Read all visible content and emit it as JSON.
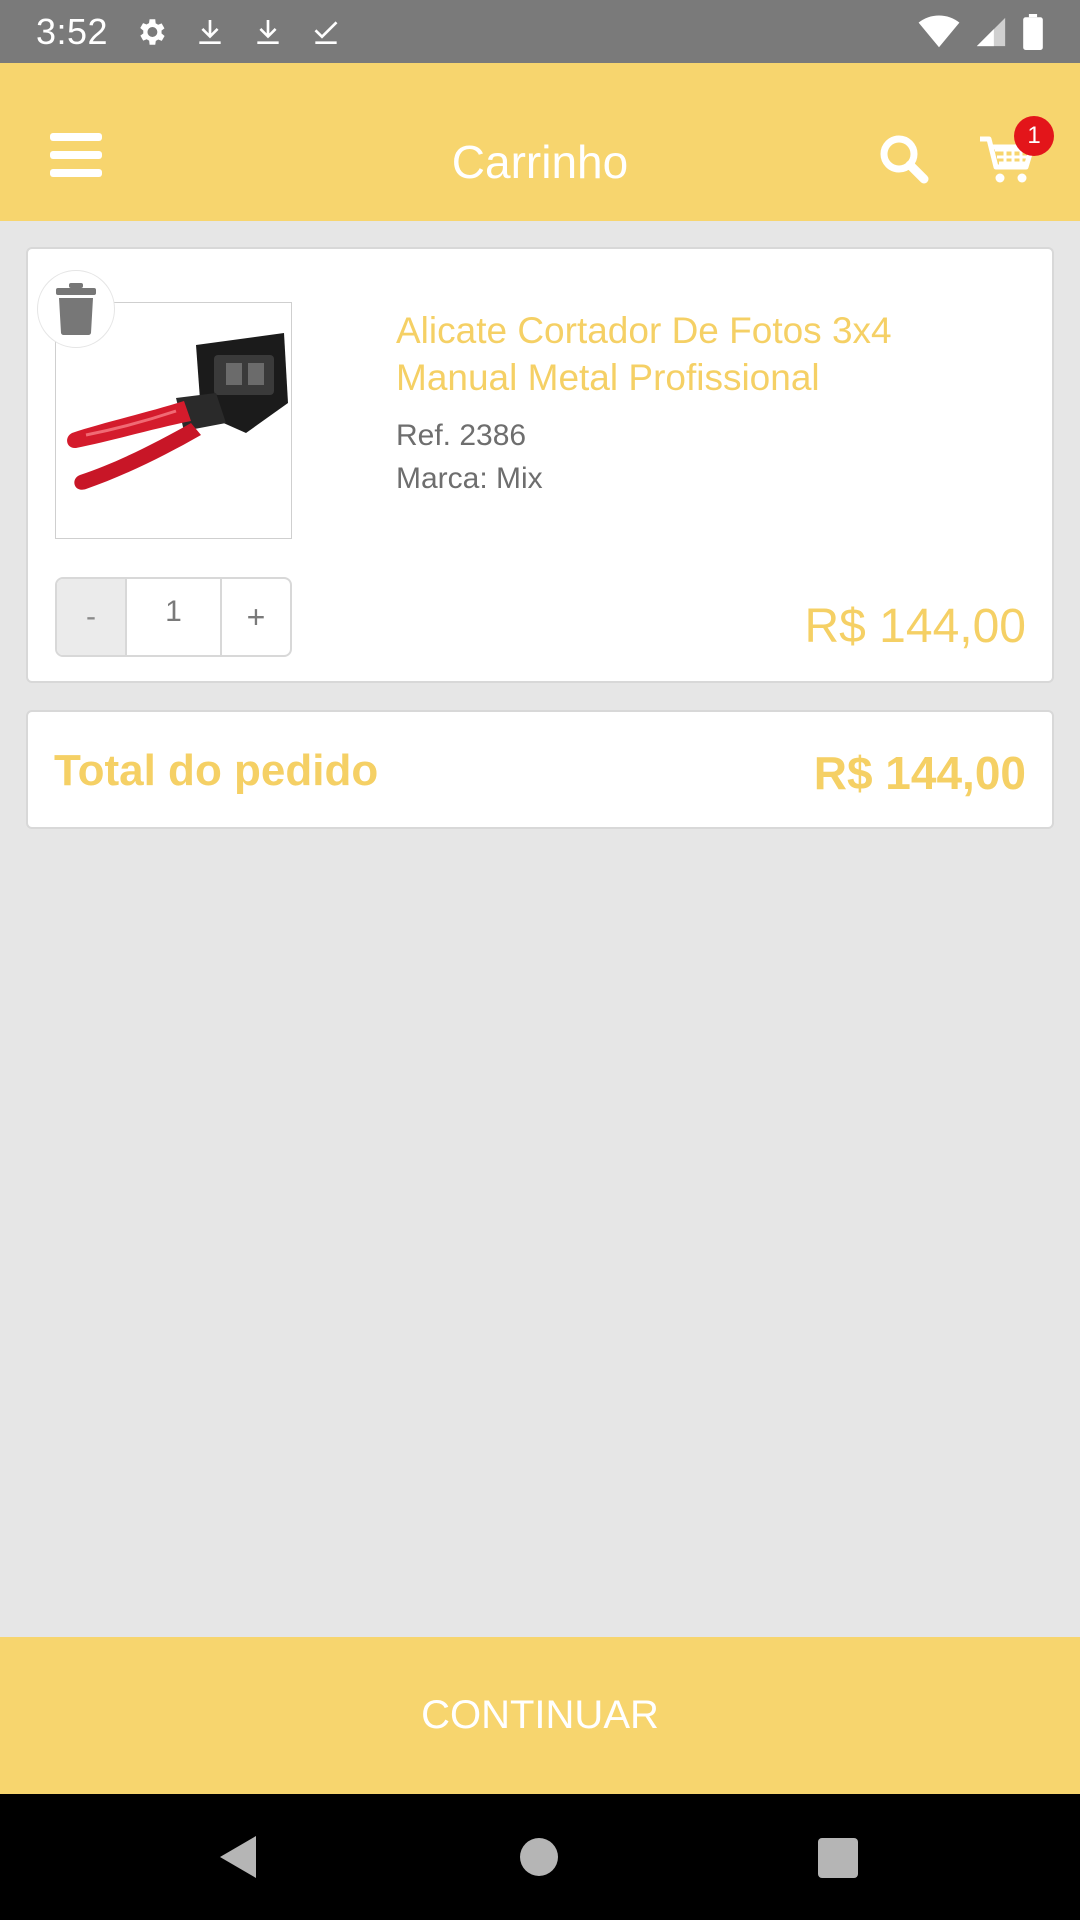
{
  "status_bar": {
    "time": "3:52",
    "icons_left": [
      "settings-icon",
      "download-icon",
      "download-icon",
      "download-done-icon"
    ],
    "icons_right": [
      "wifi-icon",
      "signal-icon",
      "battery-icon"
    ]
  },
  "app_bar": {
    "title": "Carrinho",
    "cart_count": "1",
    "colors": {
      "background": "#f7d56e",
      "badge": "#e3151a"
    }
  },
  "cart_item": {
    "name": "Alicate Cortador De Fotos 3x4 Manual Metal Profissional",
    "ref": "Ref. 2386",
    "brand": "Marca: Mix",
    "quantity": "1",
    "minus_label": "-",
    "plus_label": "+",
    "price": "R$ 144,00",
    "image": "pliers-photo-cutter-image"
  },
  "total": {
    "label": "Total do pedido",
    "value": "R$ 144,00"
  },
  "footer": {
    "continue_label": "CONTINUAR"
  },
  "colors": {
    "accent": "#f5d065",
    "page_background": "#e6e6e6"
  }
}
